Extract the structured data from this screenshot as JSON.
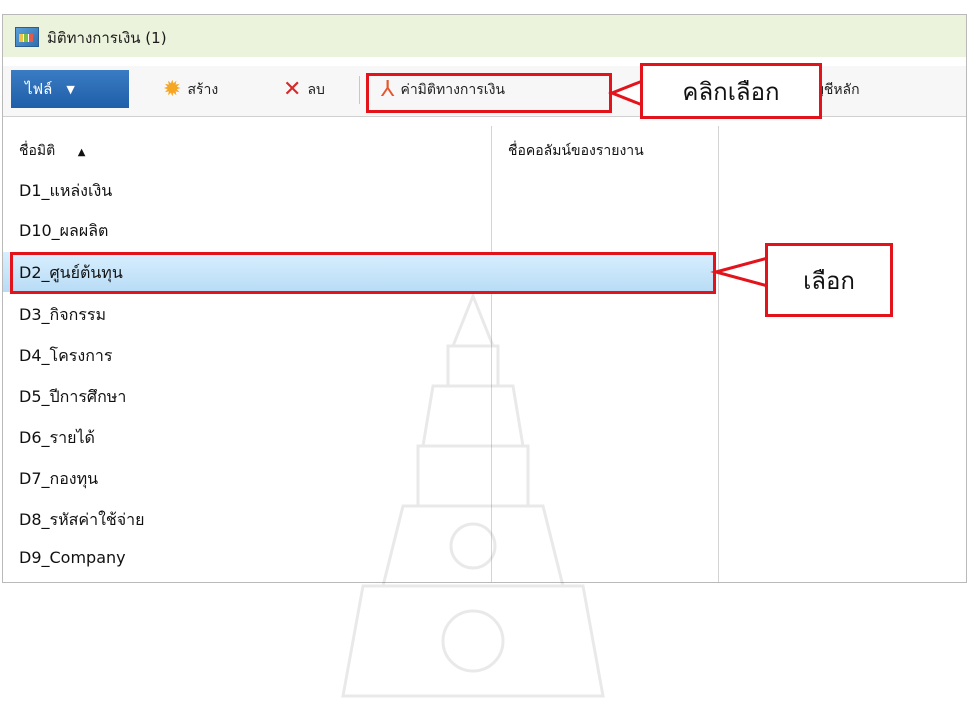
{
  "window": {
    "title": "มิติทางการเงิน (1)"
  },
  "toolbar": {
    "file_label": "ไฟล์",
    "new_label": "สร้าง",
    "delete_label": "ลบ",
    "dimension_values_label": "ค่ามิติทางการเงิน",
    "main_account_label": "บัญชีหลัก"
  },
  "columns": {
    "dimension_name": "ชื่อมิติ",
    "report_column_name": "ชื่อคอลัมน์ของรายงาน"
  },
  "rows": [
    {
      "name": "D1_แหล่งเงิน"
    },
    {
      "name": "D10_ผลผลิต"
    },
    {
      "name": "D2_ศูนย์ต้นทุน"
    },
    {
      "name": "D3_กิจกรรม"
    },
    {
      "name": "D4_โครงการ"
    },
    {
      "name": "D5_ปีการศึกษา"
    },
    {
      "name": "D6_รายได้"
    },
    {
      "name": "D7_กองทุน"
    },
    {
      "name": "D8_รหัสค่าใช้จ่าย"
    },
    {
      "name": "D9_Company"
    }
  ],
  "selected_row": "D2_ศูนย์ต้นทุน",
  "annotations": {
    "click_select": "คลิกเลือก",
    "select": "เลือก"
  },
  "colors": {
    "title_bg": "#ecf3dc",
    "file_button": "#1f5ea8",
    "highlight": "#e3131b",
    "selection": "#b8dcf5"
  }
}
